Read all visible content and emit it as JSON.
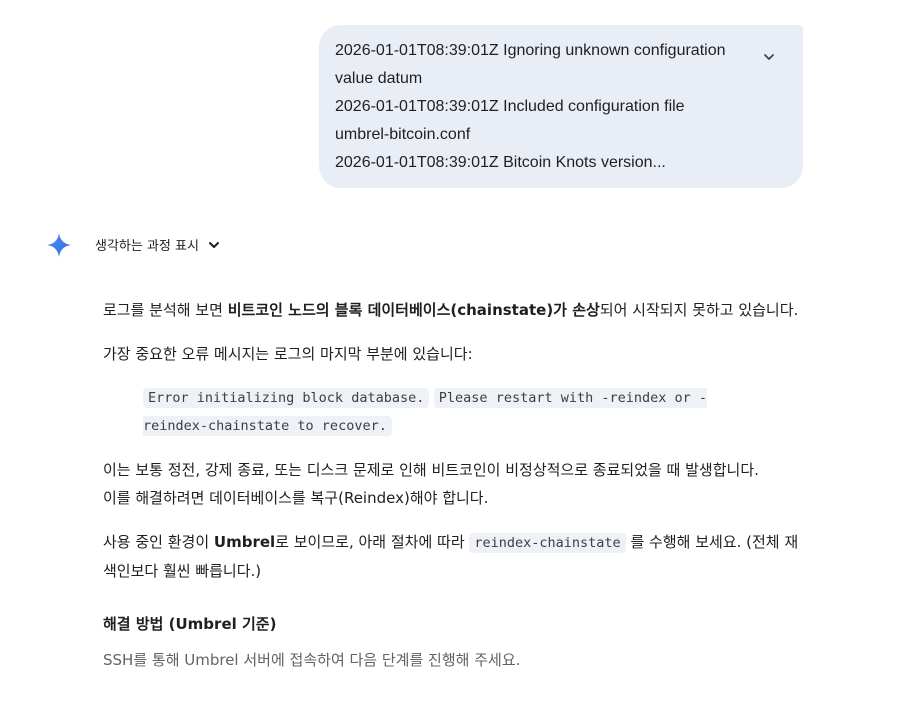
{
  "user_message": {
    "lines": [
      "2026-01-01T08:39:01Z Ignoring unknown configuration",
      "value datum",
      "2026-01-01T08:39:01Z Included configuration file",
      "umbrel-bitcoin.conf",
      "2026-01-01T08:39:01Z Bitcoin Knots version..."
    ]
  },
  "thinking": {
    "label": "생각하는 과정 표시"
  },
  "response": {
    "p1": {
      "a": "로그를 분석해 보면 ",
      "b": "비트코인 노드의 블록 데이터베이스(chainstate)가 손상",
      "c": "되어 시작되지 못하고 있습니다."
    },
    "p2": "가장 중요한 오류 메시지는 로그의 마지막 부분에 있습니다:",
    "code1": "Error initializing block database.",
    "code2": "Please restart with -reindex or -reindex-chainstate to recover.",
    "p3_line1": "이는 보통 정전, 강제 종료, 또는 디스크 문제로 인해 비트코인이 비정상적으로 종료되었을 때 발생합니다.",
    "p3_line2": "이를 해결하려면 데이터베이스를 복구(Reindex)해야 합니다.",
    "p4": {
      "a": "사용 중인 환경이 ",
      "b": "Umbrel",
      "c": "로 보이므로, 아래 절차에 따라 ",
      "code": "reindex-chainstate",
      "d": " 를 수행해 보세요. (전체 재색인보다 훨씬 빠릅니다.)"
    },
    "heading": "해결 방법 (Umbrel 기준)",
    "p5": "SSH를 통해 Umbrel 서버에 접속하여 다음 단계를 진행해 주세요."
  },
  "colors": {
    "bubble": "#e9eef6",
    "spark_blue": "#4285f4",
    "code_bg": "#eef1f6"
  },
  "icons": {
    "bubble_toggle": "chevron-down-icon",
    "spark": "gemini-spark-icon",
    "thinking_toggle": "chevron-down-icon"
  }
}
